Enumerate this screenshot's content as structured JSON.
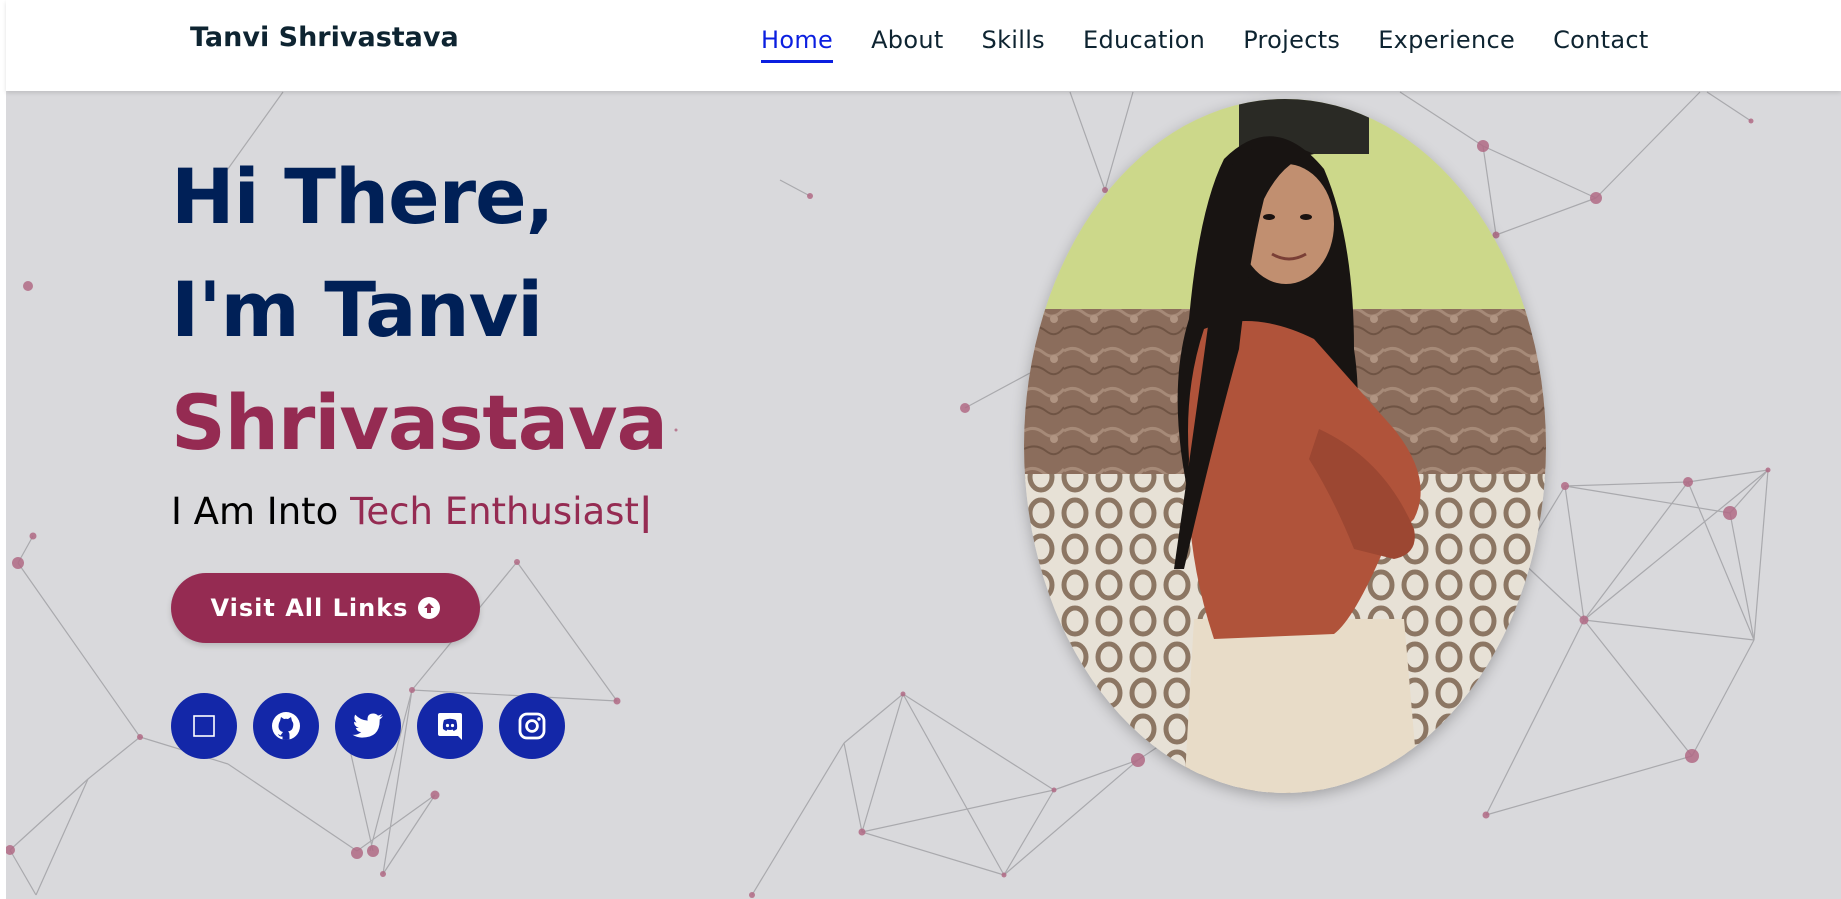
{
  "brand": {
    "name": "Tanvi Shrivastava"
  },
  "nav": {
    "items": [
      {
        "label": "Home",
        "active": true
      },
      {
        "label": "About",
        "active": false
      },
      {
        "label": "Skills",
        "active": false
      },
      {
        "label": "Education",
        "active": false
      },
      {
        "label": "Projects",
        "active": false
      },
      {
        "label": "Experience",
        "active": false
      },
      {
        "label": "Contact",
        "active": false
      }
    ]
  },
  "hero": {
    "greeting_line1": "Hi There,",
    "greeting_line2": "I'm Tanvi",
    "name_accent": "Shrivastava",
    "typing_prefix": "I Am Into ",
    "typing_role": "Tech Enthusiast",
    "typing_cursor": "|",
    "cta_label": "Visit All Links"
  },
  "socials": [
    {
      "icon": "linkedin-icon"
    },
    {
      "icon": "github-icon"
    },
    {
      "icon": "twitter-icon"
    },
    {
      "icon": "discord-icon"
    },
    {
      "icon": "instagram-icon"
    }
  ],
  "colors": {
    "navy": "#002057",
    "accent": "#952b52",
    "nav_active": "#0b1fe0",
    "social_bg": "#1327a8",
    "background": "#d9d9dc"
  }
}
